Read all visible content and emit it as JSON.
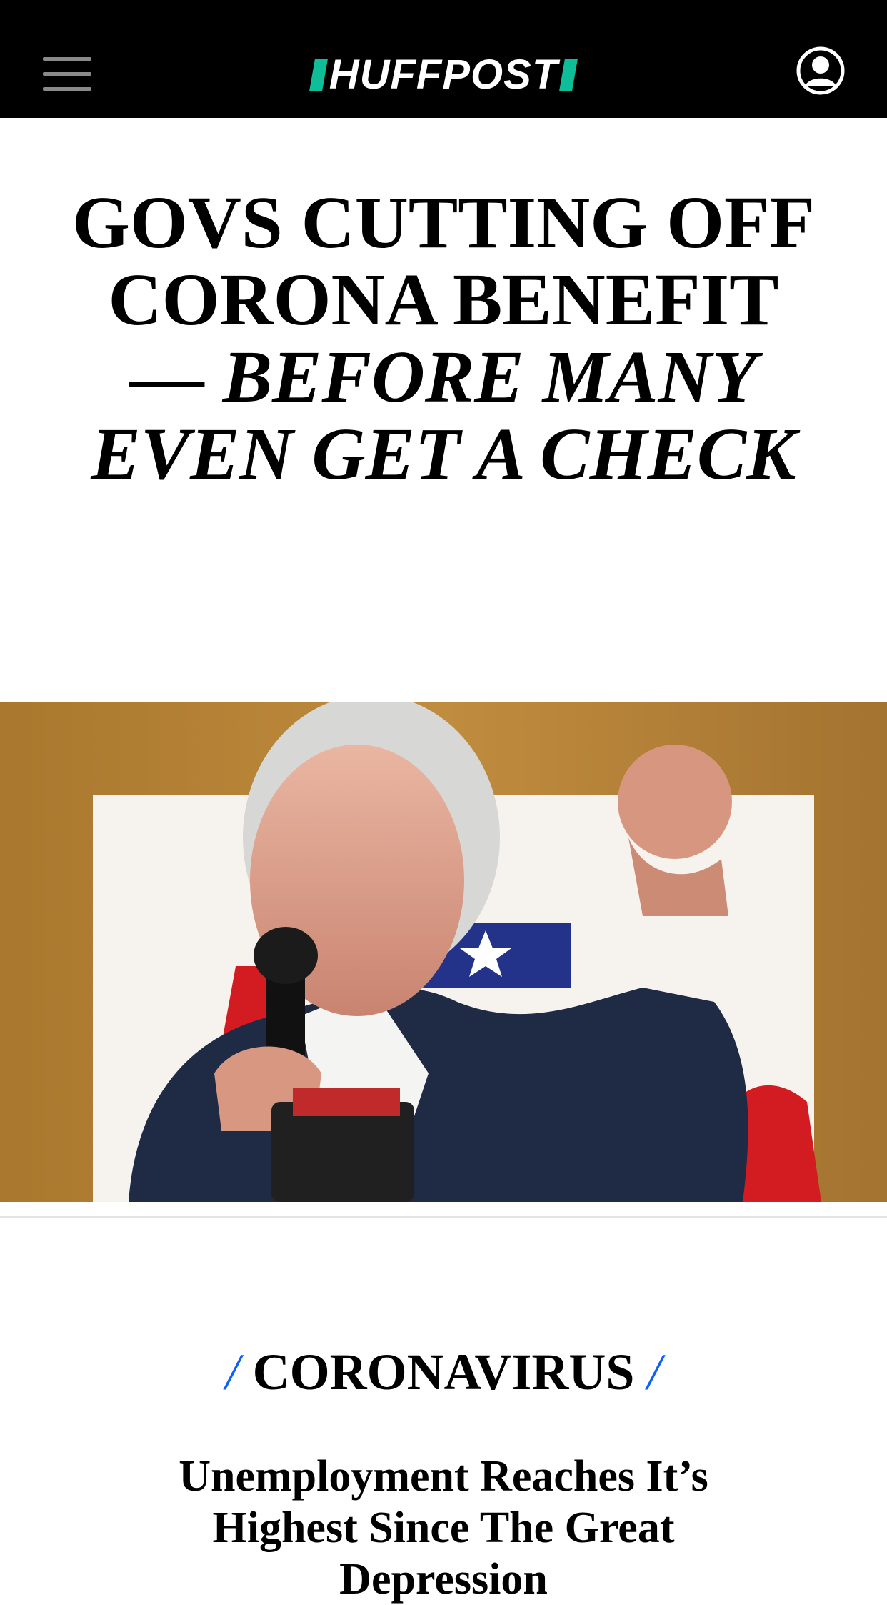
{
  "header": {
    "brand": "HUFFPOST",
    "menu_icon": "hamburger-menu-icon",
    "user_icon": "user-account-icon",
    "accent_color": "#0dbe98"
  },
  "headline": {
    "main": "GOVS CUTTING OFF CORONA BENEFIT",
    "dash": "— ",
    "italic": "BEFORE MANY EVEN GET A CHECK"
  },
  "section": {
    "slash_left": "/",
    "label": "CORONAVIRUS",
    "slash_right": "/",
    "slash_color": "#0a5fff"
  },
  "story": {
    "title": "Unemployment Reaches It’s Highest Since The Great Depression"
  }
}
